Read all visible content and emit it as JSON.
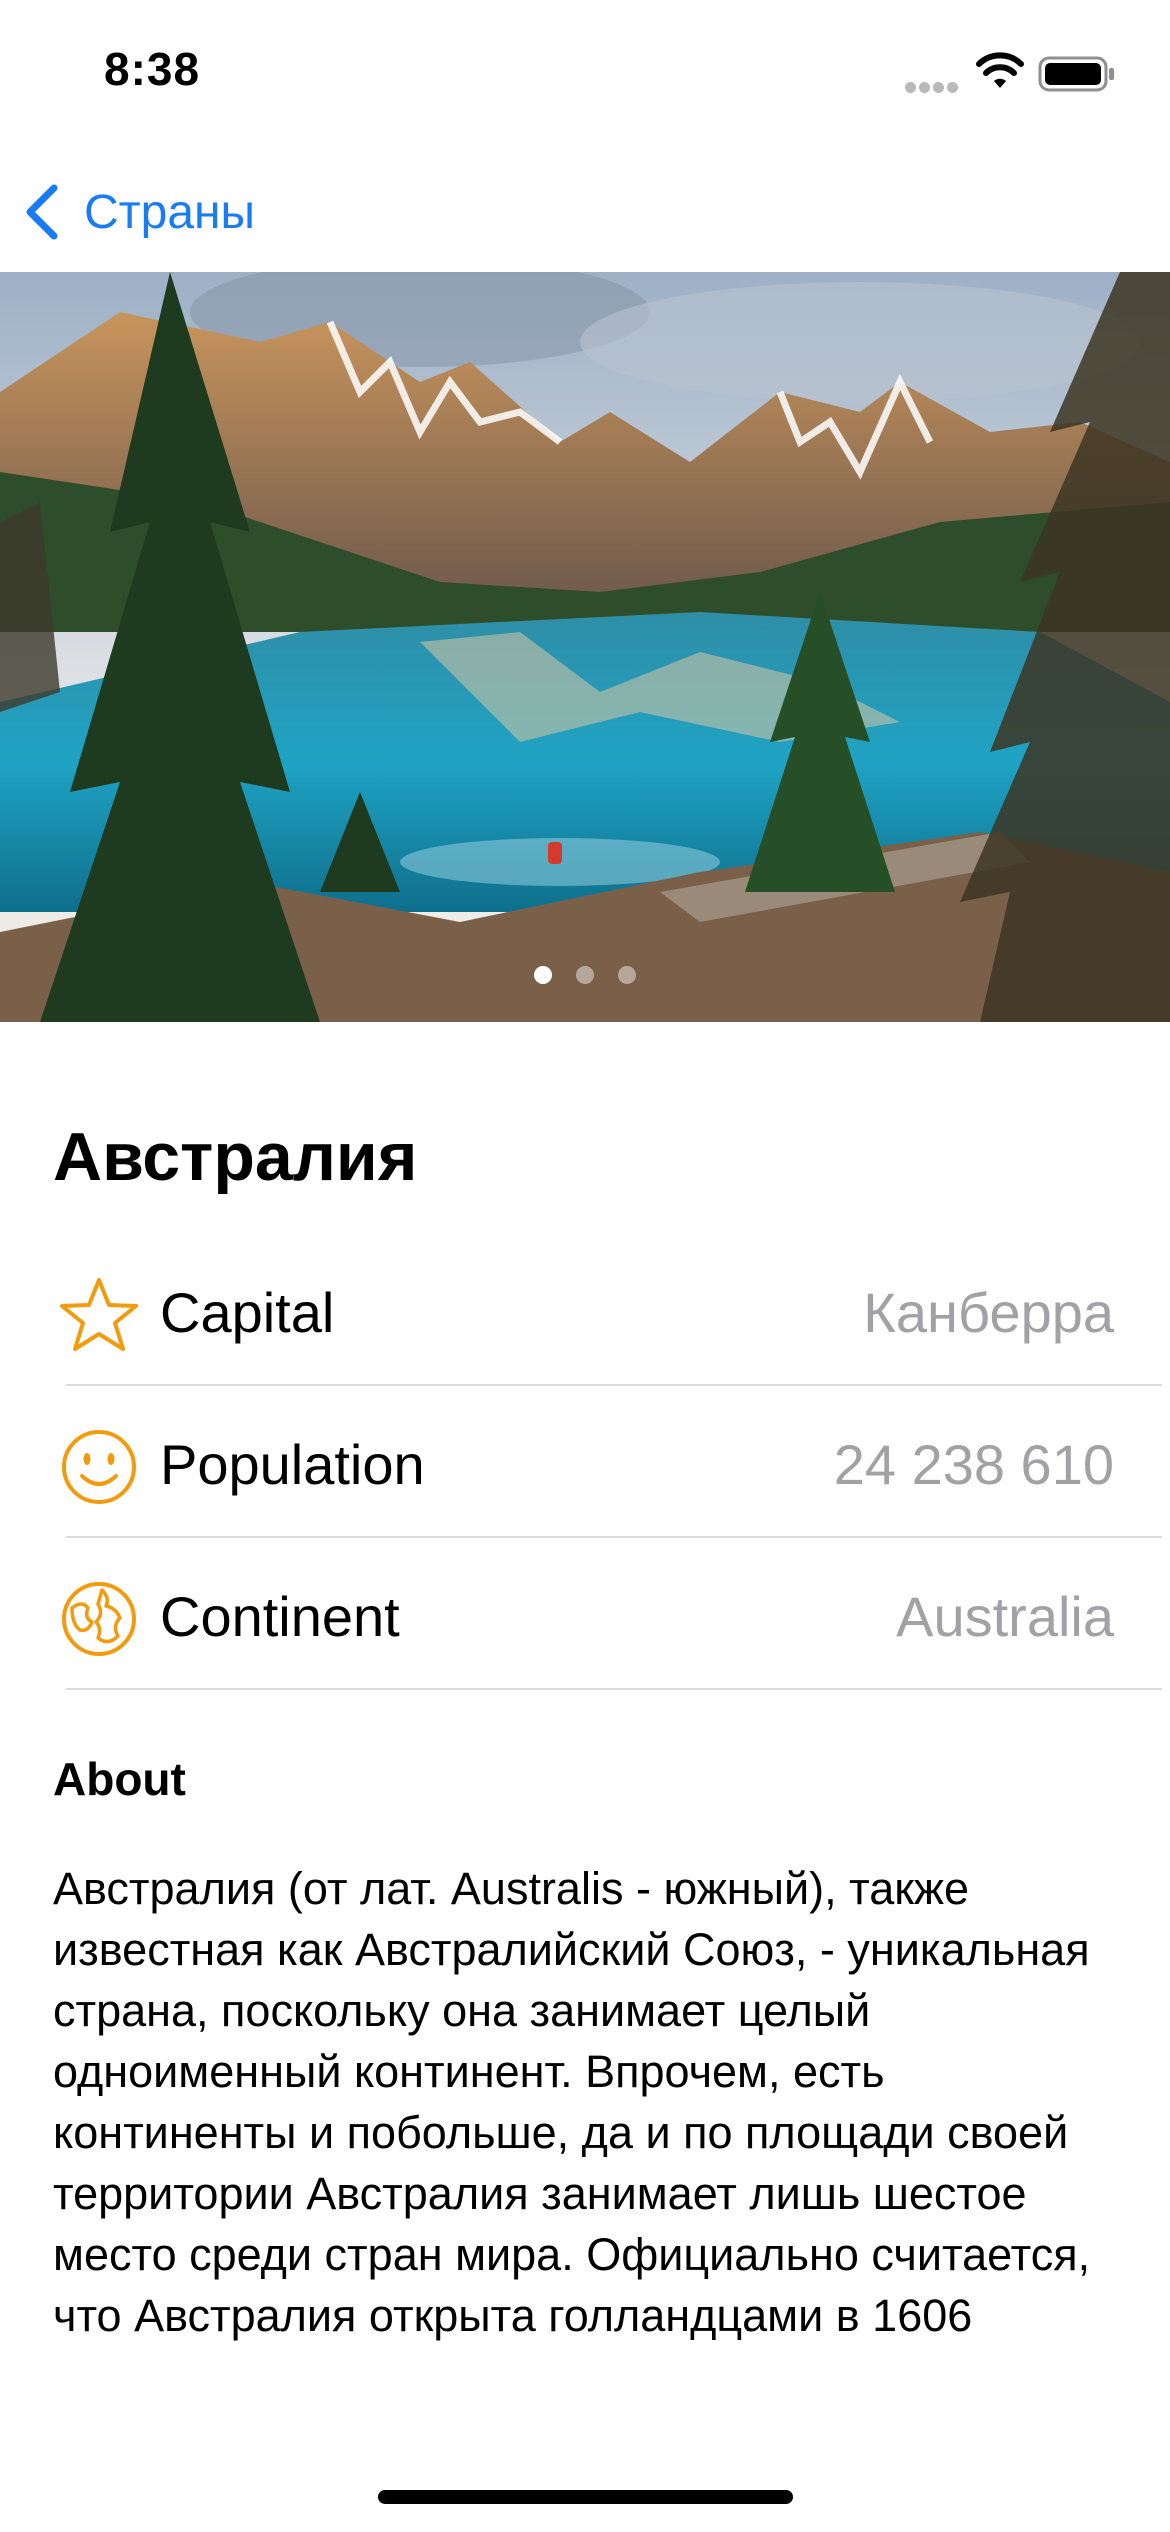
{
  "status_bar": {
    "time": "8:38"
  },
  "nav": {
    "back_label": "Страны"
  },
  "hero": {
    "page_count": 3,
    "active_page": 1
  },
  "country": {
    "name": "Австралия",
    "rows": [
      {
        "icon": "star-icon",
        "label": "Capital",
        "value": "Канберра"
      },
      {
        "icon": "smiley-icon",
        "label": "Population",
        "value": "24 238 610"
      },
      {
        "icon": "globe-icon",
        "label": "Continent",
        "value": "Australia"
      }
    ]
  },
  "about": {
    "heading": "About",
    "text": "Австралия (от лат. Australis - южный), также известная как Австралийский Союз, - уникальная страна, поскольку она занимает целый одноименный континент. Впрочем, есть континенты и побольше, да и по площади своей территории Австралия занимает лишь шестое место среди стран мира. Официально считается, что Австралия открыта голландцами в 1606"
  },
  "colors": {
    "accent": "#1a7cf2",
    "icon_orange": "#f39b0f",
    "secondary_text": "#a1a1a6"
  }
}
